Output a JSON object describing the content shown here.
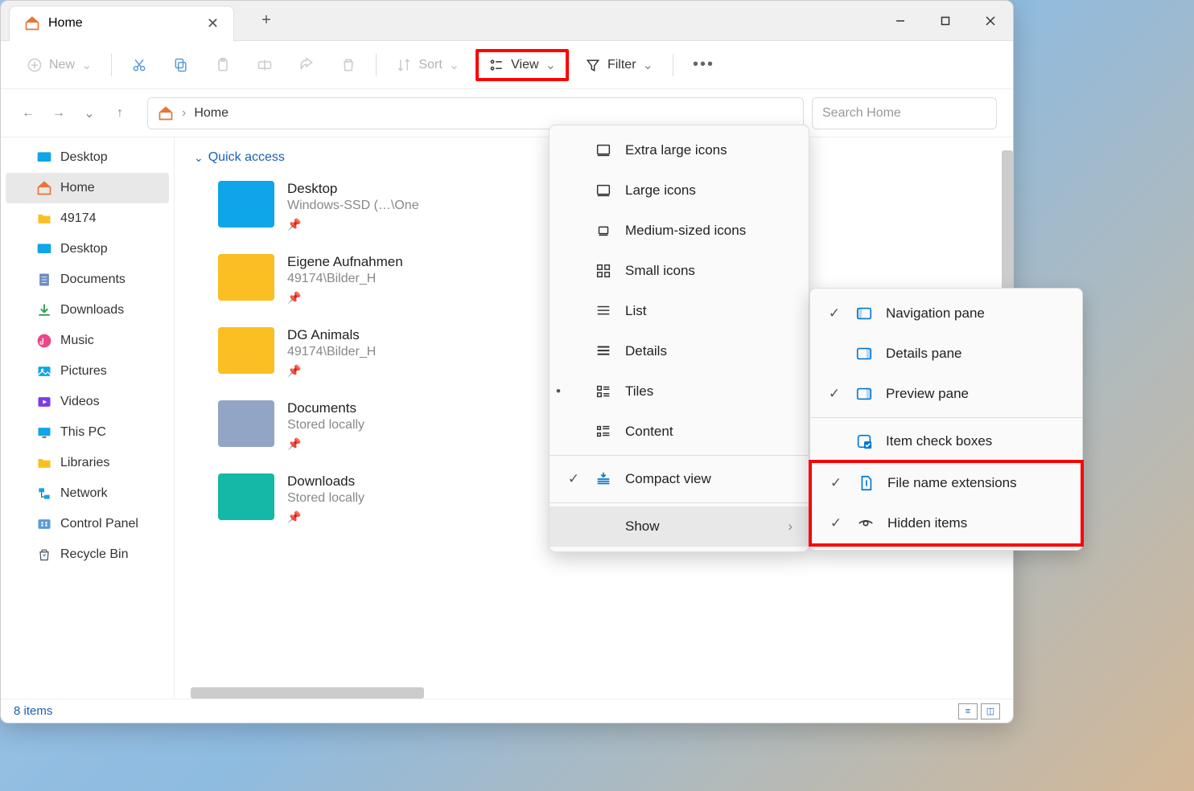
{
  "window": {
    "title": "Home"
  },
  "toolbar": {
    "new": "New",
    "sort": "Sort",
    "view": "View",
    "filter": "Filter"
  },
  "breadcrumb": {
    "location": "Home"
  },
  "search": {
    "placeholder": "Search Home"
  },
  "sidebar": {
    "items": [
      {
        "label": "Desktop",
        "icon": "desktop-img"
      },
      {
        "label": "Home",
        "icon": "home",
        "active": true
      },
      {
        "label": "49174",
        "icon": "folder"
      },
      {
        "label": "Desktop",
        "icon": "desktop-img"
      },
      {
        "label": "Documents",
        "icon": "document"
      },
      {
        "label": "Downloads",
        "icon": "download"
      },
      {
        "label": "Music",
        "icon": "music"
      },
      {
        "label": "Pictures",
        "icon": "pictures"
      },
      {
        "label": "Videos",
        "icon": "videos"
      },
      {
        "label": "This PC",
        "icon": "pc"
      },
      {
        "label": "Libraries",
        "icon": "folder"
      },
      {
        "label": "Network",
        "icon": "network"
      },
      {
        "label": "Control Panel",
        "icon": "control"
      },
      {
        "label": "Recycle Bin",
        "icon": "recycle"
      }
    ]
  },
  "content": {
    "section": "Quick access",
    "items": [
      {
        "name": "Desktop",
        "path": "Windows-SSD (…\\One",
        "color": "#0ea5e9"
      },
      {
        "name": "Eigene Aufnahmen",
        "path": "49174\\Bilder_H",
        "color": "#fbbf24"
      },
      {
        "name": "DG Animals",
        "path": "49174\\Bilder_H",
        "color": "#fbbf24"
      },
      {
        "name": "Documents",
        "path": "Stored locally",
        "color": "#93a5c4"
      },
      {
        "name": "Downloads",
        "path": "Stored locally",
        "color": "#14b8a6"
      }
    ]
  },
  "viewMenu": {
    "items": [
      {
        "label": "Extra large icons",
        "icon": "monitor"
      },
      {
        "label": "Large icons",
        "icon": "monitor"
      },
      {
        "label": "Medium-sized icons",
        "icon": "monitor-sm"
      },
      {
        "label": "Small icons",
        "icon": "grid"
      },
      {
        "label": "List",
        "icon": "list"
      },
      {
        "label": "Details",
        "icon": "details"
      },
      {
        "label": "Tiles",
        "icon": "tiles",
        "bullet": true
      },
      {
        "label": "Content",
        "icon": "content"
      }
    ],
    "compact": "Compact view",
    "show": "Show"
  },
  "showMenu": {
    "items": [
      {
        "label": "Navigation pane",
        "checked": true,
        "icon": "pane-left"
      },
      {
        "label": "Details pane",
        "checked": false,
        "icon": "pane-right"
      },
      {
        "label": "Preview pane",
        "checked": true,
        "icon": "pane-right"
      },
      {
        "label": "Item check boxes",
        "checked": false,
        "icon": "checkbox"
      },
      {
        "label": "File name extensions",
        "checked": true,
        "icon": "file",
        "highlight": true
      },
      {
        "label": "Hidden items",
        "checked": true,
        "icon": "eye",
        "highlight": true
      }
    ]
  },
  "status": {
    "count": "8 items"
  }
}
